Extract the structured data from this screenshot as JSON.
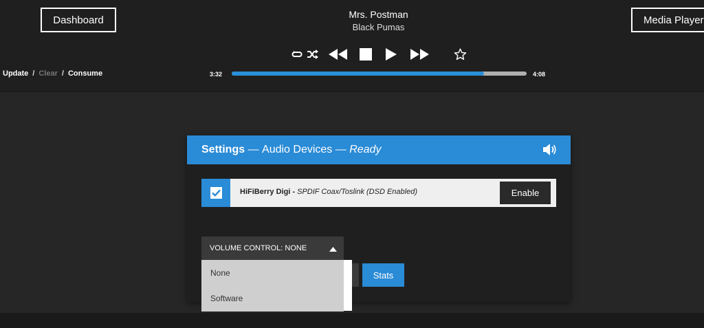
{
  "nav": {
    "dashboard_label": "Dashboard",
    "media_player_label": "Media Player"
  },
  "now_playing": {
    "title": "Mrs. Postman",
    "artist": "Black Pumas",
    "elapsed": "3:32",
    "duration": "4:08",
    "progress_percent": 85.5
  },
  "controls": {
    "icons": [
      "repeat-icon",
      "shuffle-icon",
      "previous-icon",
      "stop-icon",
      "play-icon",
      "next-icon",
      "star-icon"
    ]
  },
  "queue_actions": {
    "update": "Update",
    "sep1": "/",
    "clear": "Clear",
    "sep2": "/",
    "consume": "Consume"
  },
  "settings": {
    "title_strong": "Settings",
    "title_dash1": " — ",
    "title_section": "Audio Devices",
    "title_dash2": " — ",
    "title_status": "Ready",
    "device": {
      "name": "HiFiBerry Digi -",
      "description": " SPDIF Coax/Toslink (DSD Enabled)",
      "checked": true,
      "action_label": "Enable"
    },
    "volume_control": {
      "label": "VOLUME CONTROL: NONE",
      "options": [
        "None",
        "Software"
      ]
    },
    "stats_label": "Stats"
  },
  "colors": {
    "accent": "#2a8bd6",
    "background": "#262626",
    "header": "#1f1f1f"
  }
}
